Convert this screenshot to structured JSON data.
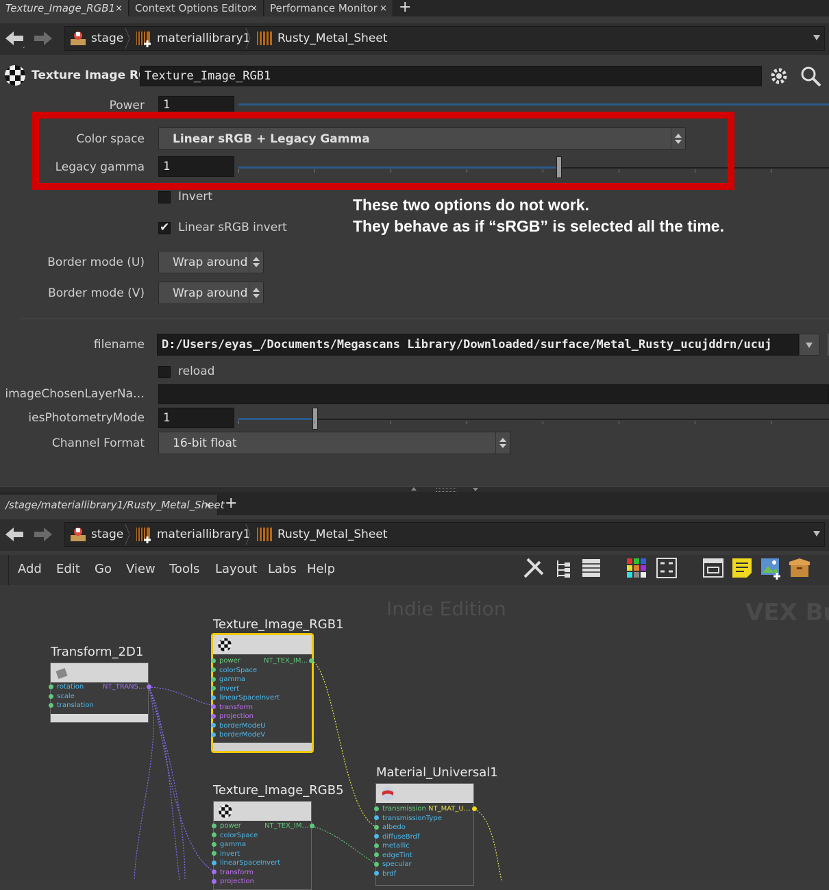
{
  "top_tabs": [
    {
      "label": "Texture_Image_RGB1",
      "close": "×"
    },
    {
      "label": "Context Options Editor",
      "close": "×"
    },
    {
      "label": "Performance Monitor",
      "close": "×"
    }
  ],
  "tab_plus": "+",
  "path": {
    "items": [
      "stage",
      "materiallibrary1",
      "Rusty_Metal_Sheet"
    ]
  },
  "node_header": {
    "type_label": "Texture Image RGB",
    "name": "Texture_Image_RGB1"
  },
  "params": {
    "power": {
      "label": "Power",
      "value": "1"
    },
    "color_space": {
      "label": "Color space",
      "value": "Linear sRGB + Legacy Gamma"
    },
    "legacy_gamma": {
      "label": "Legacy gamma",
      "value": "1",
      "slider_fraction": 0.53
    },
    "invert": {
      "label": "Invert",
      "checked": false
    },
    "linear_srgb_invert": {
      "label": "Linear sRGB invert",
      "checked": true,
      "check": "✔"
    },
    "border_u": {
      "label": "Border mode (U)",
      "value": "Wrap around"
    },
    "border_v": {
      "label": "Border mode (V)",
      "value": "Wrap around"
    },
    "filename": {
      "label": "filename",
      "value": "D:/Users/eyas_/Documents/Megascans Library/Downloaded/surface/Metal_Rusty_ucujddrn/ucuj"
    },
    "reload": {
      "label": "reload",
      "checked": false
    },
    "image_layer": {
      "label": "imageChosenLayerNa…",
      "value": ""
    },
    "ies": {
      "label": "iesPhotometryMode",
      "value": "1",
      "slider_fraction": 0.13
    },
    "channel_format": {
      "label": "Channel Format",
      "value": "16-bit float"
    }
  },
  "annotation": {
    "line1": "These two options do not work.",
    "line2": "They behave as if “sRGB” is selected all the time.",
    "highlight_color": "#d40000"
  },
  "network_tab": {
    "label": "/stage/materiallibrary1/Rusty_Metal_Sheet",
    "close": "×",
    "plus": "+"
  },
  "menu": [
    "Add",
    "Edit",
    "Go",
    "View",
    "Tools",
    "Layout",
    "Labs",
    "Help"
  ],
  "watermarks": {
    "edition": "Indie Edition",
    "context": "VEX Bui"
  },
  "nodes": {
    "transform": {
      "title": "Transform_2D1",
      "inputs": [
        "rotation",
        "scale",
        "translation"
      ],
      "output": "NT_TRANS…"
    },
    "tex1": {
      "title": "Texture_Image_RGB1",
      "inputs": [
        "power",
        "colorSpace",
        "gamma",
        "invert",
        "linearSpaceInvert",
        "transform",
        "projection",
        "borderModeU",
        "borderModeV"
      ],
      "output": "NT_TEX_IM…"
    },
    "tex5": {
      "title": "Texture_Image_RGB5",
      "inputs": [
        "power",
        "colorSpace",
        "gamma",
        "invert",
        "linearSpaceInvert",
        "transform",
        "projection"
      ],
      "output": "NT_TEX_IM…"
    },
    "material": {
      "title": "Material_Universal1",
      "inputs": [
        "transmission",
        "transmissionType",
        "albedo",
        "diffuseBrdf",
        "metallic",
        "edgeTint",
        "specular",
        "brdf"
      ],
      "output": "NT_MAT_U…"
    }
  },
  "colors": {
    "accent_blue": "#2b5a8c",
    "selected_node": "#f0c800",
    "port_green": "#5fc87a",
    "port_cyan": "#4fb8e8",
    "port_purple": "#a070f0",
    "wire_yellow": "#e8e040",
    "wire_purple": "#8a6cf0"
  }
}
